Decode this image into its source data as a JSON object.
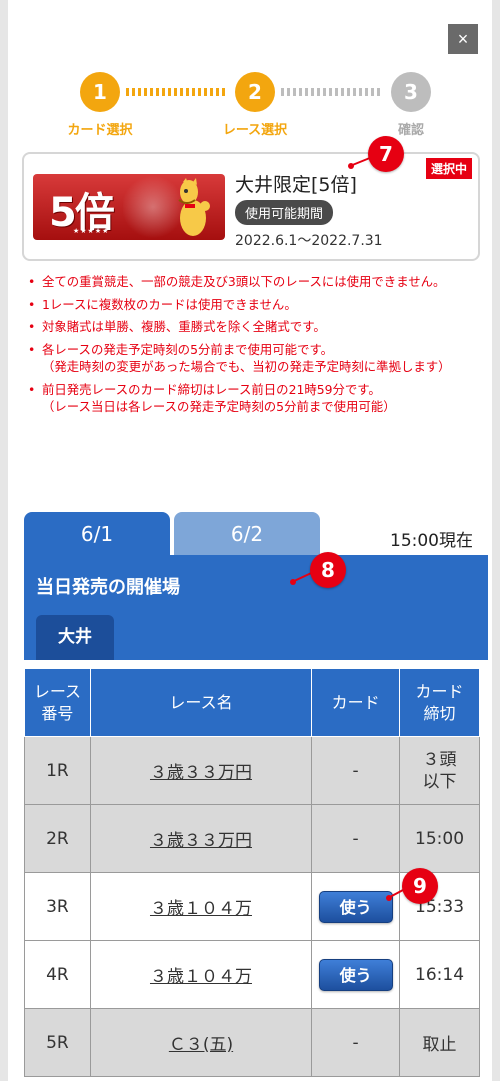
{
  "close_label": "×",
  "steps": [
    {
      "number": "1",
      "label": "カード選択",
      "state": "active"
    },
    {
      "number": "2",
      "label": "レース選択",
      "state": "active"
    },
    {
      "number": "3",
      "label": "確認",
      "state": "inactive"
    }
  ],
  "card": {
    "multiplier": "5倍",
    "stars": "★★★★★",
    "title": "大井限定[5倍]",
    "period_label": "使用可能期間",
    "period_dates": "2022.6.1〜2022.7.31",
    "selected_badge": "選択中"
  },
  "callouts": {
    "c7": "7",
    "c8": "8",
    "c9": "9"
  },
  "notes": [
    "全ての重賞競走、一部の競走及び3頭以下のレースには使用できません。",
    "1レースに複数枚のカードは使用できません。",
    "対象賭式は単勝、複勝、重勝式を除く全賭式です。",
    "各レースの発走予定時刻の5分前まで使用可能です。\n（発走時刻の変更があった場合でも、当初の発走予定時刻に準拠します）",
    "前日発売レースのカード締切はレース前日の21時59分です。\n（レース当日は各レースの発走予定時刻の5分前まで使用可能）"
  ],
  "date_tabs": [
    {
      "label": "6/1",
      "active": true
    },
    {
      "label": "6/2",
      "active": false
    }
  ],
  "as_of": "15:00現在",
  "venue": {
    "title": "当日発売の開催場",
    "tab_label": "大井"
  },
  "table": {
    "headers": [
      "レース\n番号",
      "レース名",
      "カード",
      "カード\n締切"
    ],
    "rows": [
      {
        "race": "1R",
        "name": "３歳３３万円",
        "card": "-",
        "deadline": "３頭\n以下",
        "deadline_red": true,
        "state": "closed"
      },
      {
        "race": "2R",
        "name": "３歳３３万円",
        "card": "-",
        "deadline": "15:00",
        "deadline_red": false,
        "state": "closed"
      },
      {
        "race": "3R",
        "name": "３歳１０４万",
        "card": "使う",
        "deadline": "15:33",
        "deadline_red": false,
        "state": "open"
      },
      {
        "race": "4R",
        "name": "３歳１０４万",
        "card": "使う",
        "deadline": "16:14",
        "deadline_red": false,
        "state": "open"
      },
      {
        "race": "5R",
        "name": "Ｃ３(五)",
        "card": "-",
        "deadline": "取止",
        "deadline_red": true,
        "state": "closed"
      }
    ]
  },
  "colors": {
    "accent_orange": "#f3a60f",
    "primary_blue": "#2b6cc4",
    "alert_red": "#e60012"
  }
}
